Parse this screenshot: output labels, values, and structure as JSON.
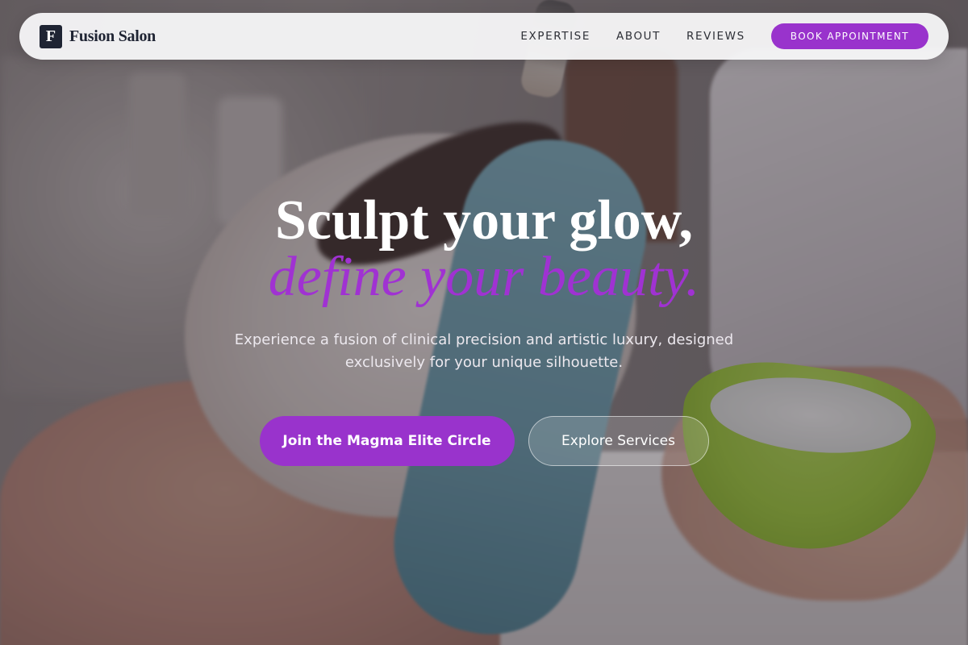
{
  "brand": {
    "logo_letter": "F",
    "name": "Fusion Salon"
  },
  "nav": {
    "links": [
      "EXPERTISE",
      "ABOUT",
      "REVIEWS"
    ],
    "cta_label": "BOOK APPOINTMENT"
  },
  "hero": {
    "headline_line1": "Sculpt your glow,",
    "headline_line2": "define your beauty.",
    "subtext": "Experience a fusion of clinical precision and artistic luxury, designed exclusively for your unique silhouette.",
    "primary_cta": "Join the Magma Elite Circle",
    "secondary_cta": "Explore Services"
  },
  "colors": {
    "accent": "#9933cc",
    "headline_accent": "#a032d2",
    "brand_dark": "#1f2433",
    "nav_bg": "#f5f5f6"
  }
}
